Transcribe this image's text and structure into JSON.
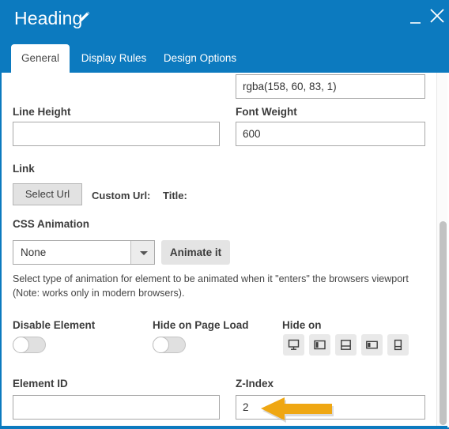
{
  "window": {
    "title": "Heading",
    "edit_icon": "pencil-icon",
    "minimize_label": "_",
    "close_label": "×",
    "accent_color": "#0c7abf"
  },
  "tabs": [
    {
      "label": "General",
      "active": true
    },
    {
      "label": "Display Rules",
      "active": false
    },
    {
      "label": "Design Options",
      "active": false
    }
  ],
  "form": {
    "color_field": {
      "value": "rgba(158, 60, 83, 1)",
      "placeholder": ""
    },
    "line_height": {
      "label": "Line Height",
      "value": "",
      "placeholder": ""
    },
    "font_weight": {
      "label": "Font Weight",
      "value": "600",
      "placeholder": ""
    },
    "link": {
      "label": "Link",
      "select_url_button": "Select Url",
      "custom_url_label": "Custom Url:",
      "custom_url_value": "",
      "title_label": "Title:",
      "title_value": ""
    },
    "css_animation": {
      "label": "CSS Animation",
      "selected": "None",
      "options": [
        "None"
      ],
      "animate_button": "Animate it",
      "help_text": "Select type of animation for element to be animated when it \"enters\" the browsers viewport (Note: works only in modern browsers)."
    },
    "disable_element": {
      "label": "Disable Element",
      "state": "off"
    },
    "hide_on_page_load": {
      "label": "Hide on Page Load",
      "state": "off"
    },
    "hide_on": {
      "label": "Hide on",
      "devices": [
        {
          "name": "desktop-icon"
        },
        {
          "name": "laptop-icon"
        },
        {
          "name": "tablet-landscape-icon"
        },
        {
          "name": "tablet-portrait-icon"
        },
        {
          "name": "mobile-icon"
        }
      ]
    },
    "element_id": {
      "label": "Element ID",
      "value": "",
      "placeholder": ""
    },
    "z_index": {
      "label": "Z-Index",
      "value": "2",
      "placeholder": ""
    }
  },
  "annotation": {
    "arrow_color": "#efa713",
    "points_at": "z-index-input"
  },
  "scrollbar": {
    "orientation": "vertical"
  }
}
